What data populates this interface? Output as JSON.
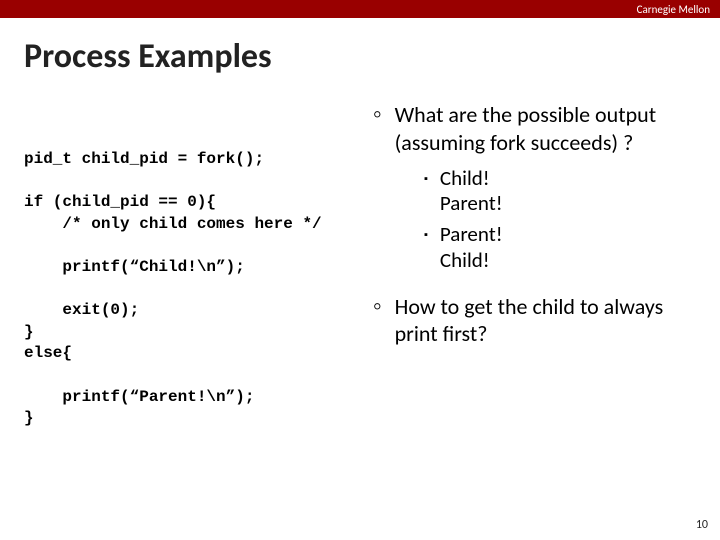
{
  "header": {
    "org": "Carnegie Mellon"
  },
  "title": "Process Examples",
  "code": "pid_t child_pid = fork();\n\nif (child_pid == 0){\n    /* only child comes here */\n\n    printf(“Child!\\n”);\n\n    exit(0);\n}\nelse{\n\n    printf(“Parent!\\n”);\n}",
  "bullets": {
    "q1": "What are the possible output  (assuming fork succeeds) ?",
    "a1": "Child!\nParent!",
    "a2": "Parent!\nChild!",
    "q2": "How to get the child to always print first?"
  },
  "page": "10"
}
